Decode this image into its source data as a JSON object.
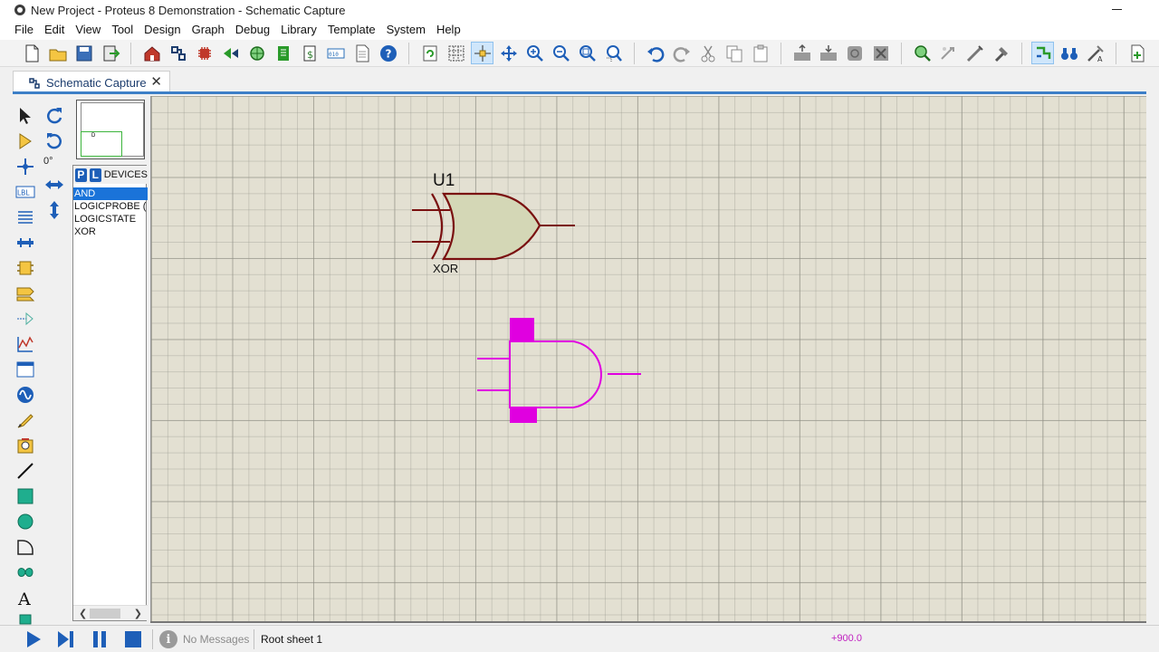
{
  "window": {
    "title": "New Project - Proteus 8 Demonstration - Schematic Capture"
  },
  "menu": [
    "File",
    "Edit",
    "View",
    "Tool",
    "Design",
    "Graph",
    "Debug",
    "Library",
    "Template",
    "System",
    "Help"
  ],
  "tab": {
    "label": "Schematic Capture",
    "close": "✕"
  },
  "rotation": {
    "angle": "0°"
  },
  "devices": {
    "pick_button": "P",
    "library_button": "L",
    "title": "DEVICES",
    "items": [
      "AND",
      "LOGICPROBE (",
      "LOGICSTATE",
      "XOR"
    ],
    "selected_index": 0
  },
  "schematic": {
    "xor_gate": {
      "ref": "U1",
      "value": "XOR",
      "color": "#7a1010",
      "fill": "#d4d7b6"
    },
    "and_gate": {
      "color": "#e000e0"
    }
  },
  "preview": {
    "marker": "D"
  },
  "status": {
    "messages": "No Messages",
    "sheet": "Root sheet 1",
    "coord": "+900.0",
    "info_icon": "i"
  },
  "colors": {
    "canvas": "#e3e0d2",
    "accent": "#3d7fc7",
    "selection": "#1a73d9",
    "coord": "#c020c0"
  }
}
